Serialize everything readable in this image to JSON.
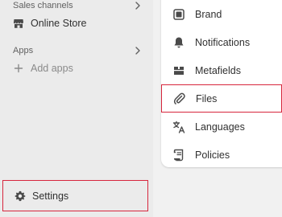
{
  "left_nav": {
    "sales_channels": {
      "header": "Sales channels",
      "items": [
        {
          "label": "Online Store",
          "icon": "store-icon"
        }
      ]
    },
    "apps": {
      "header": "Apps",
      "add_label": "Add apps"
    },
    "settings": {
      "label": "Settings",
      "icon": "gear-icon"
    }
  },
  "settings_menu": {
    "items": [
      {
        "label": "Brand",
        "icon": "brand-icon"
      },
      {
        "label": "Notifications",
        "icon": "bell-icon"
      },
      {
        "label": "Metafields",
        "icon": "metafields-icon"
      },
      {
        "label": "Files",
        "icon": "paperclip-icon"
      },
      {
        "label": "Languages",
        "icon": "translate-icon"
      },
      {
        "label": "Policies",
        "icon": "policy-icon"
      }
    ]
  },
  "colors": {
    "highlight_border": "#d7263d",
    "sidebar_bg": "#ebebeb"
  }
}
